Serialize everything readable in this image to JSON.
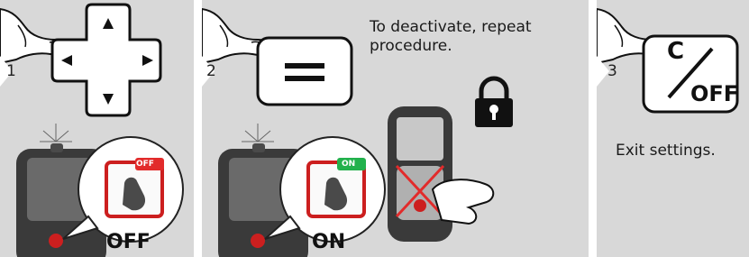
{
  "steps": [
    {
      "number": "1",
      "state_label": "OFF",
      "badge_text": "OFF",
      "badge_color": "#e22b2b"
    },
    {
      "number": "2",
      "state_label": "ON",
      "badge_text": "ON",
      "badge_color": "#22b14c",
      "instruction": "To deactivate, repeat procedure."
    },
    {
      "number": "3",
      "key_label_top": "C",
      "key_label_bottom": "OFF",
      "instruction": "Exit settings."
    }
  ],
  "icons": [
    "finger-pointer-icon",
    "navigation-pad-icon",
    "equals-key-icon",
    "lock-icon",
    "clear-off-key-icon",
    "laser-device-icon"
  ],
  "colors": {
    "panel_bg": "#d8d8d8",
    "device_body": "#3a3a3a",
    "leica_red": "#cc1f1f"
  }
}
